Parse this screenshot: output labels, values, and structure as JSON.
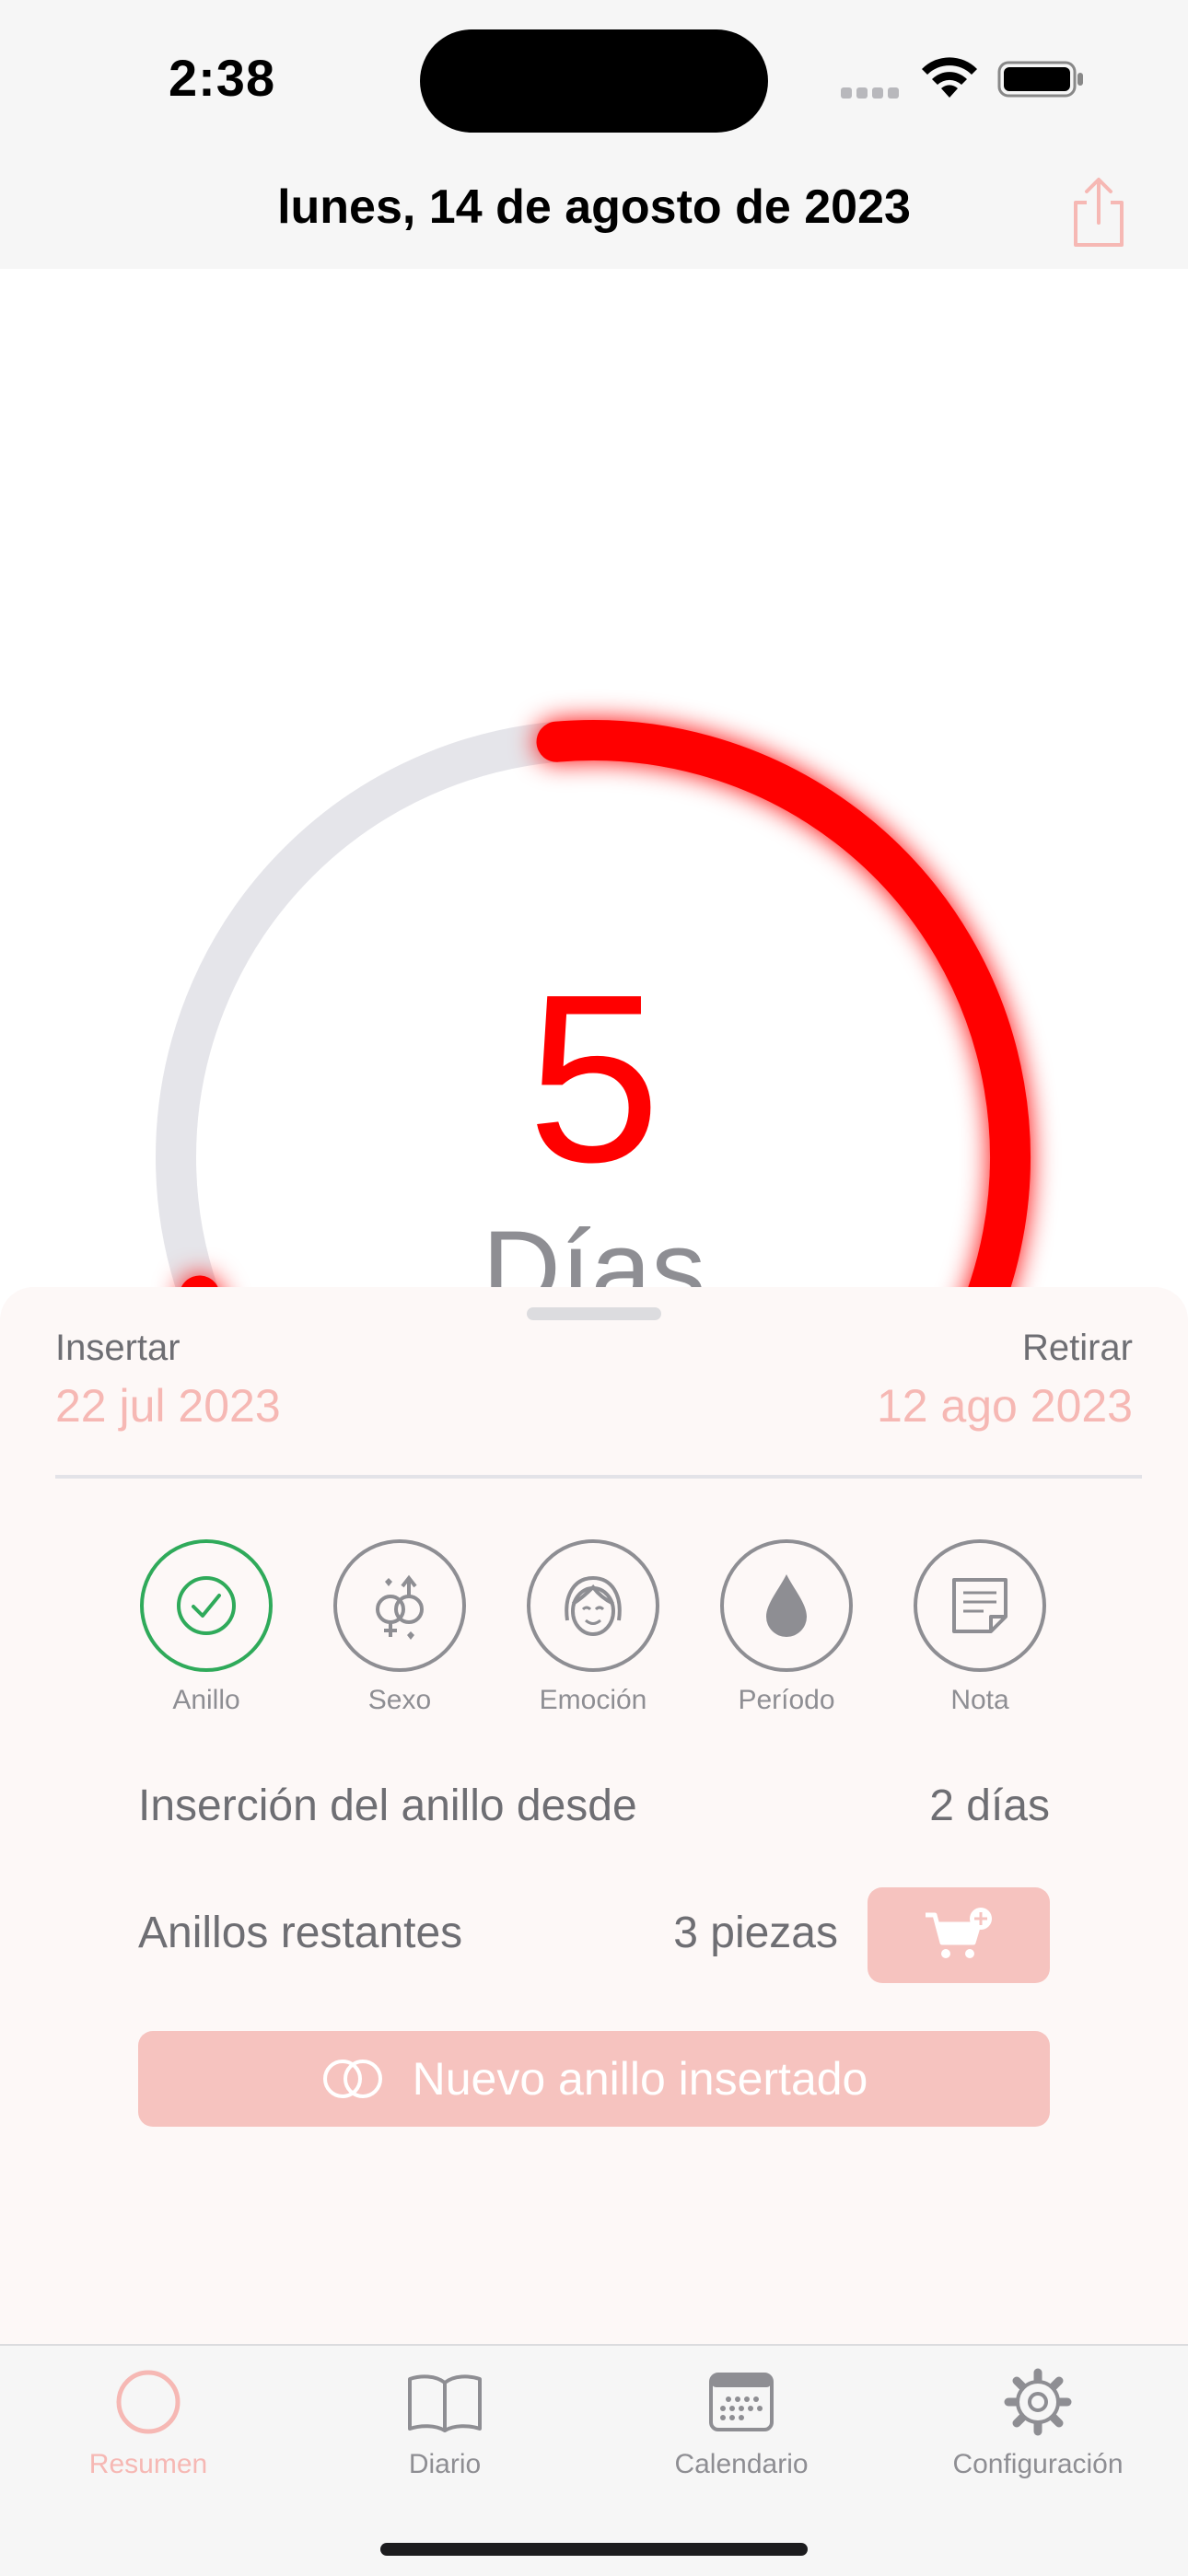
{
  "status_bar": {
    "time": "2:38"
  },
  "header": {
    "title": "lunes, 14 de agosto de 2023"
  },
  "ring": {
    "count": "5",
    "unit": "Días",
    "progress_fraction": 0.71,
    "color": "#ff0000",
    "track_color": "#e5e5ea"
  },
  "sheet": {
    "insert_label": "Insertar",
    "insert_date": "22 jul 2023",
    "remove_label": "Retirar",
    "remove_date": "12 ago 2023",
    "actions": [
      {
        "label": "Anillo",
        "icon": "check-icon",
        "active": true
      },
      {
        "label": "Sexo",
        "icon": "gender-icon",
        "active": false
      },
      {
        "label": "Emoción",
        "icon": "face-icon",
        "active": false
      },
      {
        "label": "Período",
        "icon": "drop-icon",
        "active": false
      },
      {
        "label": "Nota",
        "icon": "note-icon",
        "active": false
      }
    ],
    "since_label": "Inserción del anillo desde",
    "since_value": "2 días",
    "remaining_label": "Anillos restantes",
    "remaining_value": "3 piezas",
    "new_ring_label": "Nuevo anillo insertado"
  },
  "tabs": [
    {
      "label": "Resumen",
      "icon": "ring-icon",
      "active": true
    },
    {
      "label": "Diario",
      "icon": "book-icon",
      "active": false
    },
    {
      "label": "Calendario",
      "icon": "calendar-icon",
      "active": false
    },
    {
      "label": "Configuración",
      "icon": "gear-icon",
      "active": false
    }
  ],
  "colors": {
    "accent": "#f6b8b4",
    "button": "#f6c3bf",
    "active_check": "#2faa5a"
  }
}
